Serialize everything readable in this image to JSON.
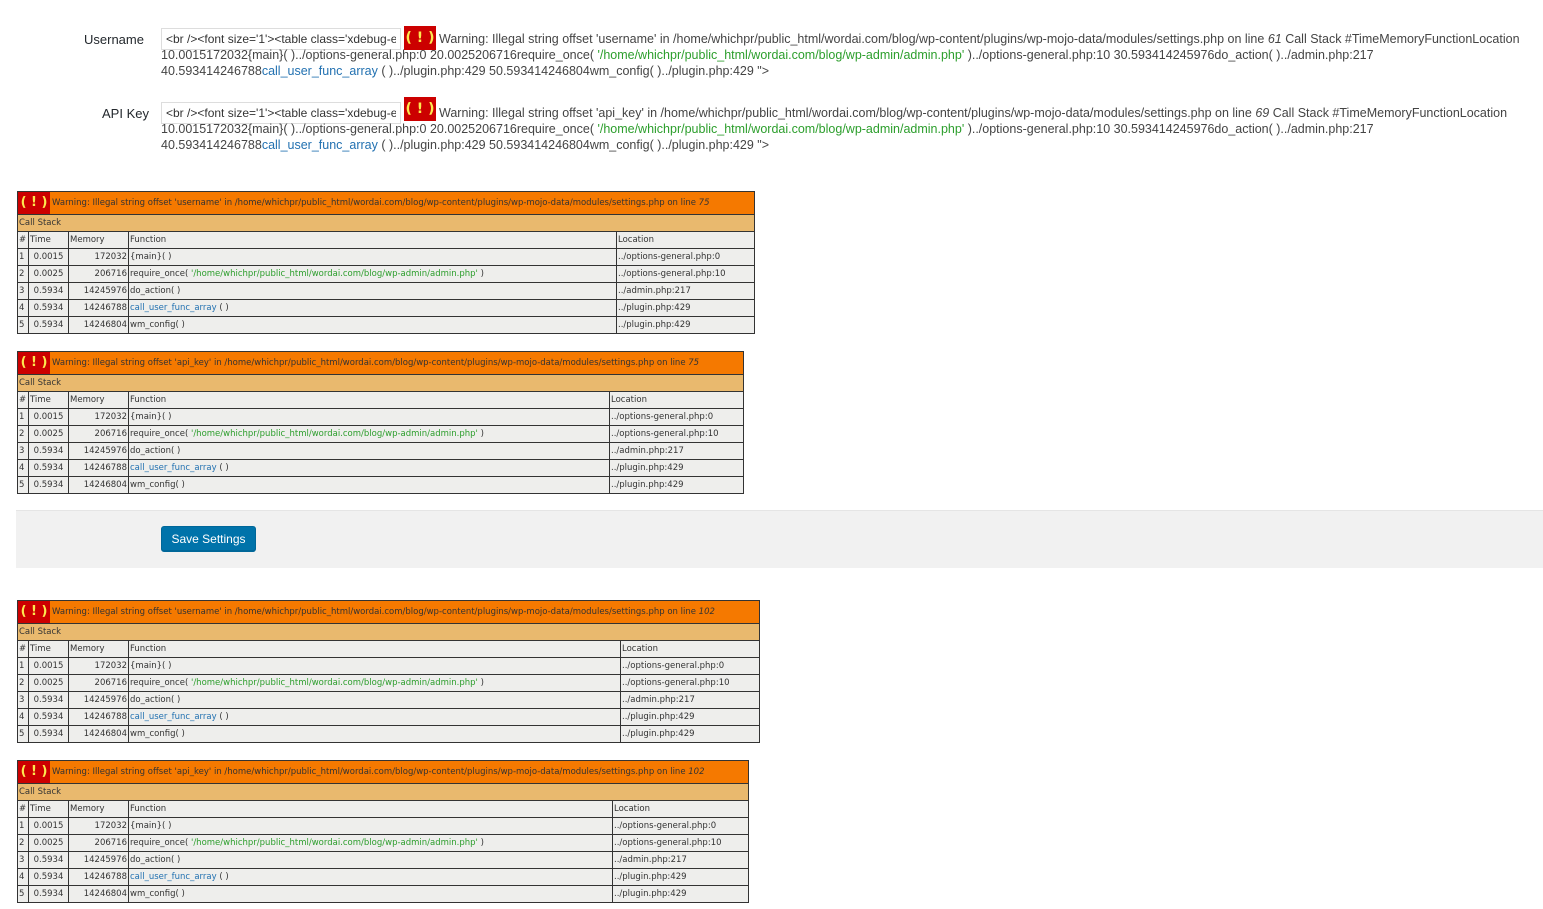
{
  "fields": [
    {
      "label": "Username",
      "input_value": "<br /><font size='1'><table class='xdebug-e",
      "warn_line1": "Warning: Illegal string offset 'username' in /home/whichpr/public_html/wordai.com/blog/wp-content/plugins/wp-mojo-data/modules/settings.php on line ",
      "warn_lineno": "61",
      "warn_line1_tail": " Call Stack #TimeMemoryFunctionLocation",
      "warn_line2_a": "10.0015172032{main}( )../options-general.php:0 20.0025206716require_once( ",
      "warn_line2_green": "'/home/whichpr/public_html/wordai.com/blog/wp-admin/admin.php'",
      "warn_line2_b": " )../options-general.php:10 30.593414245976do_action( )../admin.php:217",
      "warn_line3_a": "40.593414246788",
      "warn_line3_blue": "call_user_func_array",
      "warn_line3_b": " ( )../plugin.php:429 50.593414246804wm_config( )../plugin.php:429 \">"
    },
    {
      "label": "API Key",
      "input_value": "<br /><font size='1'><table class='xdebug-e",
      "warn_line1": "Warning: Illegal string offset 'api_key' in /home/whichpr/public_html/wordai.com/blog/wp-content/plugins/wp-mojo-data/modules/settings.php on line ",
      "warn_lineno": "69",
      "warn_line1_tail": " Call Stack #TimeMemoryFunctionLocation",
      "warn_line2_a": "10.0015172032{main}( )../options-general.php:0 20.0025206716require_once( ",
      "warn_line2_green": "'/home/whichpr/public_html/wordai.com/blog/wp-admin/admin.php'",
      "warn_line2_b": " )../options-general.php:10 30.593414245976do_action( )../admin.php:217",
      "warn_line3_a": "40.593414246788",
      "warn_line3_blue": "call_user_func_array",
      "warn_line3_b": " ( )../plugin.php:429 50.593414246804wm_config( )../plugin.php:429 \">"
    }
  ],
  "icon_glyph": "( ! )",
  "callstack_label": "Call Stack",
  "columns": [
    "#",
    "Time",
    "Memory",
    "Function",
    "Location"
  ],
  "stack_rows": [
    {
      "n": "1",
      "time": "0.0015",
      "mem": "172032",
      "fn": "{main}( )",
      "loc": "../options-general.php:0"
    },
    {
      "n": "2",
      "time": "0.0025",
      "mem": "206716",
      "fn_a": "require_once( ",
      "fn_green": "'/home/whichpr/public_html/wordai.com/blog/wp-admin/admin.php'",
      "fn_b": " )",
      "loc": "../options-general.php:10"
    },
    {
      "n": "3",
      "time": "0.5934",
      "mem": "14245976",
      "fn": "do_action( )",
      "loc": "../admin.php:217"
    },
    {
      "n": "4",
      "time": "0.5934",
      "mem": "14246788",
      "fn_blue": "call_user_func_array",
      "fn_b": " ( )",
      "loc": "../plugin.php:429"
    },
    {
      "n": "5",
      "time": "0.5934",
      "mem": "14246804",
      "fn": "wm_config( )",
      "loc": "../plugin.php:429"
    }
  ],
  "xdebug_warnings": [
    {
      "msg": "Warning: Illegal string offset 'username' in /home/whichpr/public_html/wordai.com/blog/wp-content/plugins/wp-mojo-data/modules/settings.php on line ",
      "line": "75"
    },
    {
      "msg": "Warning: Illegal string offset 'api_key' in /home/whichpr/public_html/wordai.com/blog/wp-content/plugins/wp-mojo-data/modules/settings.php on line ",
      "line": "75"
    },
    {
      "msg": "Warning: Illegal string offset 'username' in /home/whichpr/public_html/wordai.com/blog/wp-content/plugins/wp-mojo-data/modules/settings.php on line ",
      "line": "102"
    },
    {
      "msg": "Warning: Illegal string offset 'api_key' in /home/whichpr/public_html/wordai.com/blog/wp-content/plugins/wp-mojo-data/modules/settings.php on line ",
      "line": "102"
    }
  ],
  "save_button_label": "Save Settings",
  "colors": {
    "xdebug_header": "#f57900",
    "xdebug_callstack": "#e9b96e",
    "xdebug_cell": "#eeeeec",
    "icon_bg": "#cc0000",
    "icon_fg": "#fce94f",
    "button": "#0073aa",
    "string_green": "#2c9e2c",
    "link_blue": "#2271b1"
  }
}
